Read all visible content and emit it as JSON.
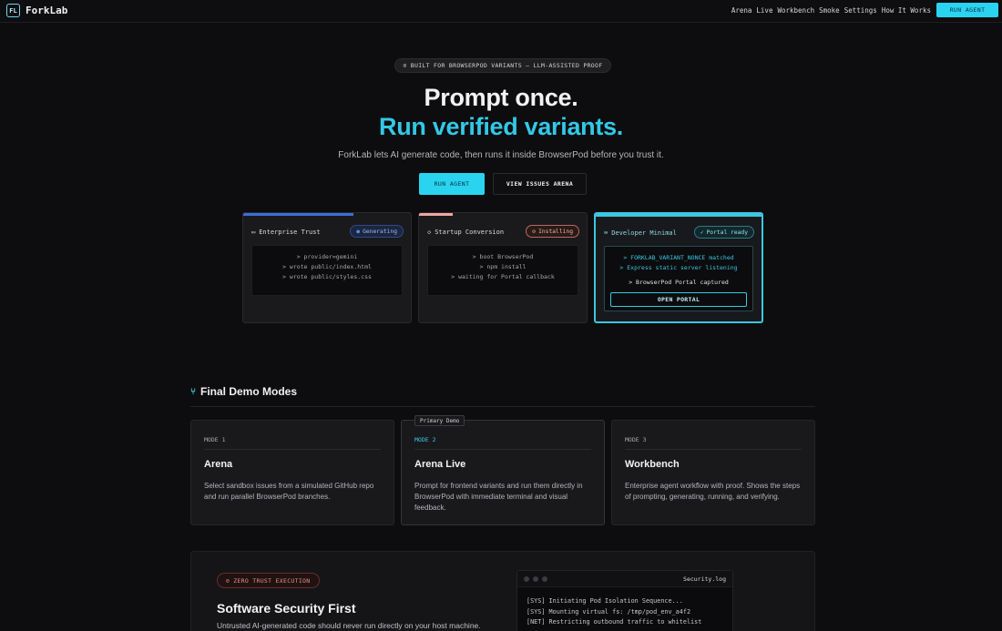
{
  "nav": {
    "logo_badge": "FL",
    "logo_text": "ForkLab",
    "links": [
      "Arena",
      "Live",
      "Workbench",
      "Smoke",
      "Settings",
      "How It Works"
    ],
    "cta": "RUN AGENT"
  },
  "hero": {
    "badge": "BUILT FOR BROWSERPOD VARIANTS — LLM-ASSISTED PROOF",
    "badge_icon": "⊙",
    "title_line1": "Prompt once.",
    "title_line2": "Run verified variants.",
    "subtitle": "ForkLab lets AI generate code, then runs it inside BrowserPod before you trust it.",
    "primary_button": "RUN AGENT",
    "secondary_button": "VIEW ISSUES ARENA"
  },
  "variants": [
    {
      "icon": "▭",
      "title": "Enterprise Trust",
      "status": "Generating",
      "status_icon": "●",
      "progress": 0.66,
      "accent": "#3a6fd8",
      "lines": [
        "> provider=gemini",
        "> wrote public/index.html",
        "> wrote public/styles.css"
      ]
    },
    {
      "icon": "◇",
      "title": "Startup Conversion",
      "status": "Installing",
      "status_icon": "⊙",
      "progress": 0.2,
      "accent": "#f0a7a0",
      "lines": [
        "> boot BrowserPod",
        "> npm install",
        "> waiting for Portal callback"
      ]
    },
    {
      "icon": "⌨",
      "title": "Developer Minimal",
      "status": "Portal ready",
      "status_icon": "✓",
      "progress": 1.0,
      "accent": "#3cc7e2",
      "lines": [
        "> FORKLAB_VARIANT_NONCE matched",
        "> Express static server listening"
      ],
      "captured": "> BrowserPod Portal captured",
      "button": "OPEN PORTAL"
    }
  ],
  "modes": {
    "section_icon": "⑂",
    "section_title": "Final Demo Modes",
    "primary_tag": "Primary Demo",
    "cards": [
      {
        "label": "MODE 1",
        "title": "Arena",
        "desc": "Select sandbox issues from a simulated GitHub repo and run parallel BrowserPod branches."
      },
      {
        "label": "MODE 2",
        "title": "Arena Live",
        "desc": "Prompt for frontend variants and run them directly in BrowserPod with immediate terminal and visual feedback."
      },
      {
        "label": "MODE 3",
        "title": "Workbench",
        "desc": "Enterprise agent workflow with proof. Shows the steps of prompting, generating, running, and verifying."
      }
    ]
  },
  "security": {
    "badge_icon": "⊘",
    "badge": "ZERO TRUST EXECUTION",
    "title": "Software Security First",
    "desc": "Untrusted AI-generated code should never run directly on your host machine.",
    "log_file": "Security.log",
    "log_lines": [
      "[SYS] Initiating Pod Isolation Sequence...",
      "[SYS] Mounting virtual fs: /tmp/pod_env_a4f2",
      "[NET] Restricting outbound traffic to whitelist"
    ]
  },
  "colors": {
    "accent_cyan": "#2ad3f0",
    "title_cyan": "#33c8e6",
    "background": "#0d0d0f"
  }
}
